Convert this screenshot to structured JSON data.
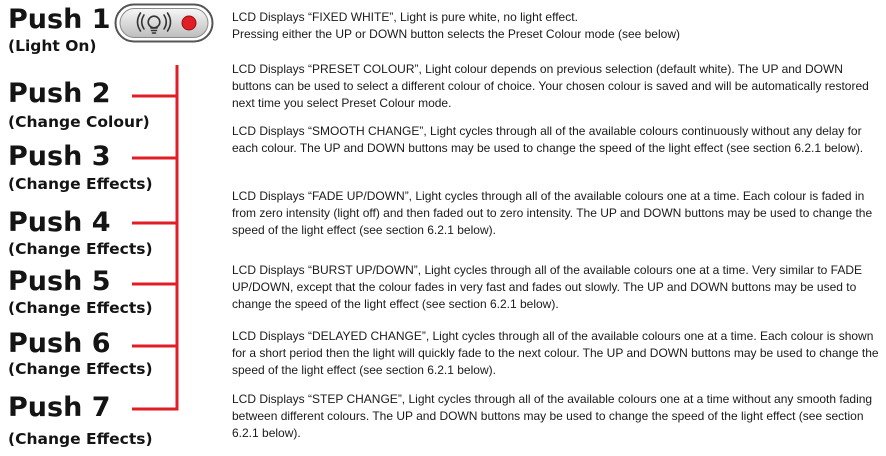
{
  "pushes": [
    {
      "label": "Push 1",
      "action": "(Light On)",
      "description": "LCD Displays “FIXED WHITE”, Light is pure white, no light effect.\nPressing either the UP or DOWN button selects the Preset Colour mode (see below)"
    },
    {
      "label": "Push 2",
      "action": "(Change Colour)",
      "description": "LCD Displays “PRESET COLOUR”, Light colour depends on previous selection (default white).  The UP and DOWN buttons can be used to select a different colour of choice.  Your chosen colour is saved and will be automatically restored next time you select Preset Colour mode."
    },
    {
      "label": "Push 3",
      "action": "(Change Effects)",
      "description": "LCD Displays “SMOOTH CHANGE”, Light cycles through all of the available colours continuously without any delay for each colour.  The UP and DOWN buttons may be used to change the speed of the light effect (see section 6.2.1 below)."
    },
    {
      "label": "Push 4",
      "action": "(Change Effects)",
      "description": "LCD Displays “FADE UP/DOWN”, Light cycles through all of the available colours one at a time.  Each colour is faded in from zero intensity (light off) and then faded out to zero intensity.  The UP and DOWN buttons may be used to change the speed of the light effect (see section 6.2.1 below)."
    },
    {
      "label": "Push 5",
      "action": "(Change Effects)",
      "description": "LCD Displays “BURST UP/DOWN”, Light cycles through all of the available colours one at a time.  Very similar to FADE UP/DOWN, except that the colour fades in very fast and fades out slowly.  The UP and DOWN buttons may be used to change the speed of the light effect (see section 6.2.1 below)."
    },
    {
      "label": "Push 6",
      "action": "(Change Effects)",
      "description": "LCD Displays “DELAYED CHANGE”, Light cycles through all of the available colours one at a time.  Each colour is shown for a short period then the light will quickly fade to the next colour.  The UP and DOWN buttons may be used to change the speed of the light effect (see section 6.2.1 below)."
    },
    {
      "label": "Push 7",
      "action": "(Change Effects)",
      "description": "LCD Displays “STEP CHANGE”, Light cycles through all of the available colours one at a time without any smooth fading between different colours.  The UP and DOWN buttons may be used to change the speed of the light effect (see section 6.2.1 below)."
    }
  ],
  "icon": {
    "name": "light-bulb-button-icon",
    "indicator_color": "#e01e26"
  },
  "colors": {
    "bracket": "#e01e26",
    "text": "#1a1a1a"
  }
}
